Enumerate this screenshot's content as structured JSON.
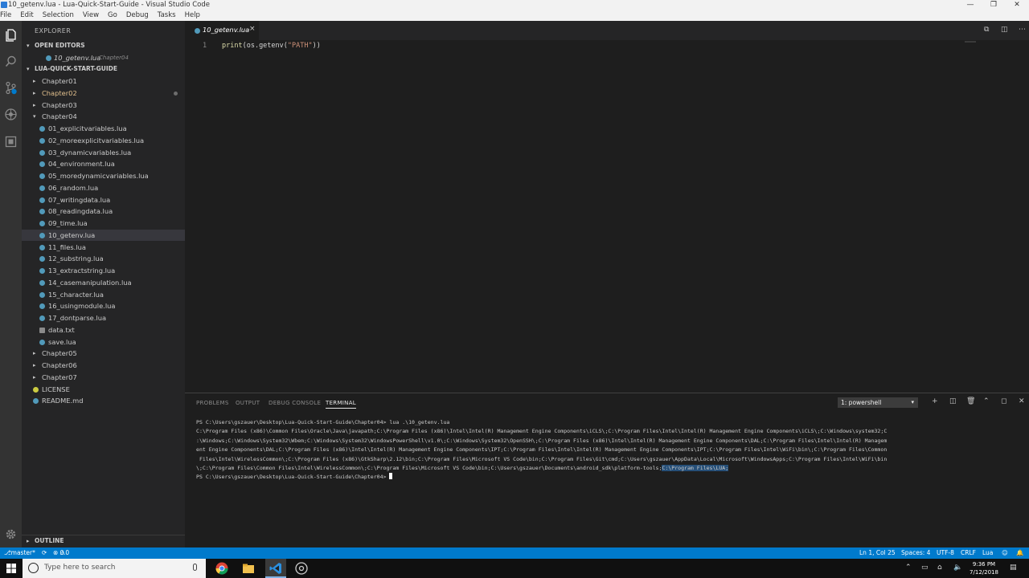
{
  "window": {
    "title": "10_getenv.lua - Lua-Quick-Start-Guide - Visual Studio Code",
    "controls": {
      "minimize": "—",
      "restore": "❐",
      "close": "✕"
    }
  },
  "menu": [
    "File",
    "Edit",
    "Selection",
    "View",
    "Go",
    "Debug",
    "Tasks",
    "Help"
  ],
  "sidebar": {
    "title": "EXPLORER",
    "open_editors_label": "OPEN EDITORS",
    "open_editor": {
      "name": "10_getenv.lua",
      "folder": "Chapter04"
    },
    "project_label": "LUA-QUICK-START-GUIDE",
    "folders_top": [
      "Chapter01",
      "Chapter02",
      "Chapter03",
      "Chapter04"
    ],
    "chapter04_files": [
      "01_explicitvariables.lua",
      "02_moreexplicitvariables.lua",
      "03_dynamicvariables.lua",
      "04_environment.lua",
      "05_moredynamicvariables.lua",
      "06_random.lua",
      "07_writingdata.lua",
      "08_readingdata.lua",
      "09_time.lua",
      "10_getenv.lua",
      "11_files.lua",
      "12_substring.lua",
      "13_extractstring.lua",
      "14_casemanipulation.lua",
      "15_character.lua",
      "16_usingmodule.lua",
      "17_dontparse.lua"
    ],
    "other_files": [
      "data.txt",
      "save.lua"
    ],
    "folders_bottom": [
      "Chapter05",
      "Chapter06",
      "Chapter07"
    ],
    "root_files": [
      "LICENSE",
      "README.md"
    ],
    "outline_label": "OUTLINE"
  },
  "editor": {
    "tab_label": "10_getenv.lua",
    "tab_close": "×",
    "line_number": "1",
    "code": {
      "fn": "print",
      "open": "(os.getenv(",
      "str": "\"PATH\"",
      "close": "))"
    }
  },
  "panel": {
    "tabs": [
      "PROBLEMS",
      "OUTPUT",
      "DEBUG CONSOLE",
      "TERMINAL"
    ],
    "active_tab": "TERMINAL",
    "terminal_select": "1: powershell",
    "terminal_lines": [
      "PS C:\\Users\\gszauer\\Desktop\\Lua-Quick-Start-Guide\\Chapter04> lua .\\10_getenv.lua",
      "C:\\Program Files (x86)\\Common Files\\Oracle\\Java\\javapath;C:\\Program Files (x86)\\Intel\\Intel(R) Management Engine Components\\iCLS\\;C:\\Program Files\\Intel\\Intel(R) Management Engine Components\\iCLS\\;C:\\Windows\\system32;C",
      ":\\Windows;C:\\Windows\\System32\\Wbem;C:\\Windows\\System32\\WindowsPowerShell\\v1.0\\;C:\\Windows\\System32\\OpenSSH\\;C:\\Program Files (x86)\\Intel\\Intel(R) Management Engine Components\\DAL;C:\\Program Files\\Intel\\Intel(R) Managem",
      "ent Engine Components\\DAL;C:\\Program Files (x86)\\Intel\\Intel(R) Management Engine Components\\IPT;C:\\Program Files\\Intel\\Intel(R) Management Engine Components\\IPT;C:\\Program Files\\Intel\\WiFi\\bin\\;C:\\Program Files\\Common",
      " Files\\Intel\\WirelessCommon\\;C:\\Program Files (x86)\\GtkSharp\\2.12\\bin;C:\\Program Files\\Microsoft VS Code\\bin;C:\\Program Files\\Git\\cmd;C:\\Users\\gszauer\\AppData\\Local\\Microsoft\\WindowsApps;C:\\Program Files\\Intel\\WiFi\\bin",
      "\\;C:\\Program Files\\Common Files\\Intel\\WirelessCommon\\;C:\\Program Files\\Microsoft VS Code\\bin;C:\\Users\\gszauer\\Documents\\android_sdk\\platform-tools;"
    ],
    "terminal_highlight": "C:\\Program Files\\LUA;",
    "prompt": "PS C:\\Users\\gszauer\\Desktop\\Lua-Quick-Start-Guide\\Chapter04> "
  },
  "statusbar": {
    "branch": "master*",
    "errors": "0",
    "warnings": "0",
    "position": "Ln 1, Col 25",
    "spaces": "Spaces: 4",
    "encoding": "UTF-8",
    "eol": "CRLF",
    "language": "Lua"
  },
  "taskbar": {
    "search_placeholder": "Type here to search",
    "time": "9:36 PM",
    "date": "7/12/2018"
  },
  "colors": {
    "accent": "#007acc",
    "modified": "#e2c08d",
    "lua_icon": "#519aba"
  }
}
